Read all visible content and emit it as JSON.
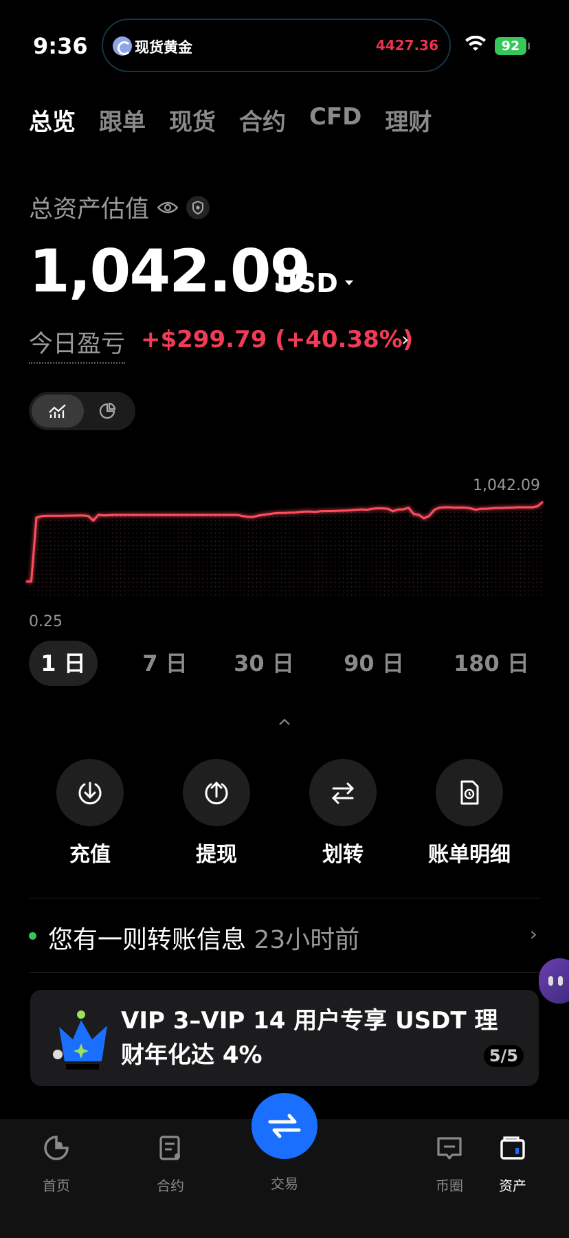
{
  "status_bar": {
    "time": "9:36",
    "island_label": "现货黄金",
    "island_price": "4427.36",
    "battery": "92"
  },
  "tabs": [
    {
      "label": "总览",
      "active": true
    },
    {
      "label": "跟单",
      "active": false
    },
    {
      "label": "现货",
      "active": false
    },
    {
      "label": "合约",
      "active": false
    },
    {
      "label": "CFD",
      "active": false
    },
    {
      "label": "理财",
      "active": false
    }
  ],
  "asset": {
    "label": "总资产估值",
    "value": "1,042.09",
    "unit": "USD"
  },
  "pnl": {
    "label": "今日盈亏",
    "value": "+$299.79 (+40.38%)"
  },
  "chart_data": {
    "type": "line",
    "max_label": "1,042.09",
    "min_label": "0.25",
    "ylim": [
      0,
      1042.09
    ],
    "x": [
      0,
      1,
      2,
      3,
      4,
      5,
      6,
      7,
      8,
      9,
      10,
      11,
      12,
      13,
      14,
      15,
      16,
      17,
      18,
      19,
      20,
      21,
      22,
      23,
      24,
      25,
      26,
      27,
      28,
      29,
      30,
      31,
      32,
      33,
      34,
      35,
      36,
      37,
      38,
      39,
      40,
      41,
      42,
      43,
      44,
      45,
      46,
      47,
      48,
      49,
      50,
      51,
      52,
      53,
      54,
      55,
      56,
      57,
      58,
      59,
      60,
      61,
      62,
      63,
      64,
      65,
      66,
      67,
      68,
      69,
      70,
      71,
      72,
      73,
      74,
      75,
      76,
      77,
      78,
      79,
      80,
      81,
      82,
      83,
      84,
      85,
      86,
      87,
      88,
      89,
      90,
      91,
      92,
      93,
      94,
      95,
      96,
      97,
      98,
      99,
      100
    ],
    "y": [
      0.25,
      0.25,
      820,
      840,
      845,
      845,
      845,
      845,
      848,
      848,
      850,
      850,
      845,
      780,
      860,
      850,
      855,
      858,
      858,
      858,
      858,
      858,
      858,
      858,
      858,
      858,
      858,
      858,
      858,
      858,
      858,
      858,
      858,
      858,
      858,
      858,
      858,
      858,
      858,
      858,
      858,
      858,
      840,
      830,
      830,
      850,
      860,
      870,
      880,
      885,
      885,
      890,
      892,
      900,
      905,
      905,
      900,
      910,
      912,
      912,
      915,
      918,
      920,
      925,
      930,
      935,
      930,
      945,
      950,
      950,
      945,
      910,
      935,
      935,
      960,
      870,
      860,
      810,
      845,
      930,
      960,
      965,
      965,
      960,
      962,
      960,
      950,
      930,
      945,
      945,
      950,
      955,
      955,
      960,
      960,
      965,
      965,
      965,
      965,
      980,
      1042.09
    ],
    "grid": false,
    "color": "#ff4d5e"
  },
  "ranges": [
    {
      "label": "1 日",
      "active": true
    },
    {
      "label": "7 日",
      "active": false
    },
    {
      "label": "30 日",
      "active": false
    },
    {
      "label": "90 日",
      "active": false
    },
    {
      "label": "180 日",
      "active": false
    }
  ],
  "actions": [
    {
      "label": "充值",
      "icon": "deposit-icon"
    },
    {
      "label": "提现",
      "icon": "withdraw-icon"
    },
    {
      "label": "划转",
      "icon": "transfer-icon"
    },
    {
      "label": "账单明细",
      "icon": "bill-icon"
    }
  ],
  "notice": {
    "message": "您有一则转账信息",
    "time": "23小时前"
  },
  "banner": {
    "text": "VIP 3–VIP 14 用户专享 USDT 理财年化达 4%",
    "pager": "5/5"
  },
  "bottom_nav": [
    {
      "label": "首页",
      "icon": "home-icon"
    },
    {
      "label": "合约",
      "icon": "contract-icon"
    },
    {
      "label": "交易",
      "icon": "trade-icon"
    },
    {
      "label": "币圈",
      "icon": "feed-icon"
    },
    {
      "label": "资产",
      "icon": "wallet-icon",
      "active": true
    }
  ],
  "colors": {
    "accent": "#1a6fff",
    "up": "#f03c56",
    "success": "#35c759"
  }
}
